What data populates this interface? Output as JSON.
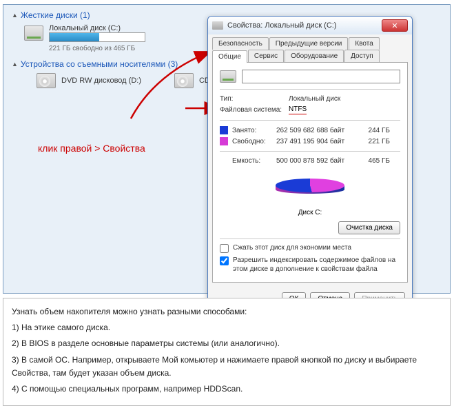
{
  "explorer": {
    "hard_drives_header": "Жесткие диски (1)",
    "local_disk_label": "Локальный диск (C:)",
    "local_disk_sub": "221 ГБ свободно из 465 ГБ",
    "removable_header": "Устройства со съемными носителями (3)",
    "dvd_label": "DVD RW дисковод (D:)",
    "cd_label": "CD-дисковод"
  },
  "hint": "клик правой > Свойства",
  "dialog": {
    "title": "Свойства: Локальный диск (C:)",
    "tabs_row1": [
      "Безопасность",
      "Предыдущие версии",
      "Квота"
    ],
    "tabs_row2": [
      "Общие",
      "Сервис",
      "Оборудование",
      "Доступ"
    ],
    "type_label": "Тип:",
    "type_value": "Локальный диск",
    "fs_label": "Файловая система:",
    "fs_value": "NTFS",
    "used_label": "Занято:",
    "used_bytes": "262 509 682 688 байт",
    "used_gb": "244 ГБ",
    "free_label": "Свободно:",
    "free_bytes": "237 491 195 904 байт",
    "free_gb": "221 ГБ",
    "cap_label": "Емкость:",
    "cap_bytes": "500 000 878 592 байт",
    "cap_gb": "465 ГБ",
    "disk_caption": "Диск C:",
    "cleanup_btn": "Очистка диска",
    "compress_label": "Сжать этот диск для экономии места",
    "index_label": "Разрешить индексировать содержимое файлов на этом диске в дополнение к свойствам файла",
    "ok": "ОК",
    "cancel": "Отмена",
    "apply": "Применить"
  },
  "desc": {
    "intro": "Узнать объем накопителя можно узнать разными способами:",
    "p1": "1) На этике самого диска.",
    "p2": "2) В BIOS в разделе основные параметры системы (или аналогично).",
    "p3": "3) В самой ОС. Например, открываете Мой комьютер и нажимаете правой кнопкой по диску и выбираете Свойства, там будет указан объем диска.",
    "p4": "4) С помощью специальных программ, например HDDScan."
  },
  "chart_data": {
    "type": "pie",
    "title": "Диск C:",
    "series": [
      {
        "name": "Занято",
        "value": 262509682688,
        "display": "244 ГБ",
        "color": "#1a3bd6"
      },
      {
        "name": "Свободно",
        "value": 237491195904,
        "display": "221 ГБ",
        "color": "#d63bd6"
      }
    ],
    "total": {
      "label": "Емкость",
      "value": 500000878592,
      "display": "465 ГБ"
    }
  }
}
